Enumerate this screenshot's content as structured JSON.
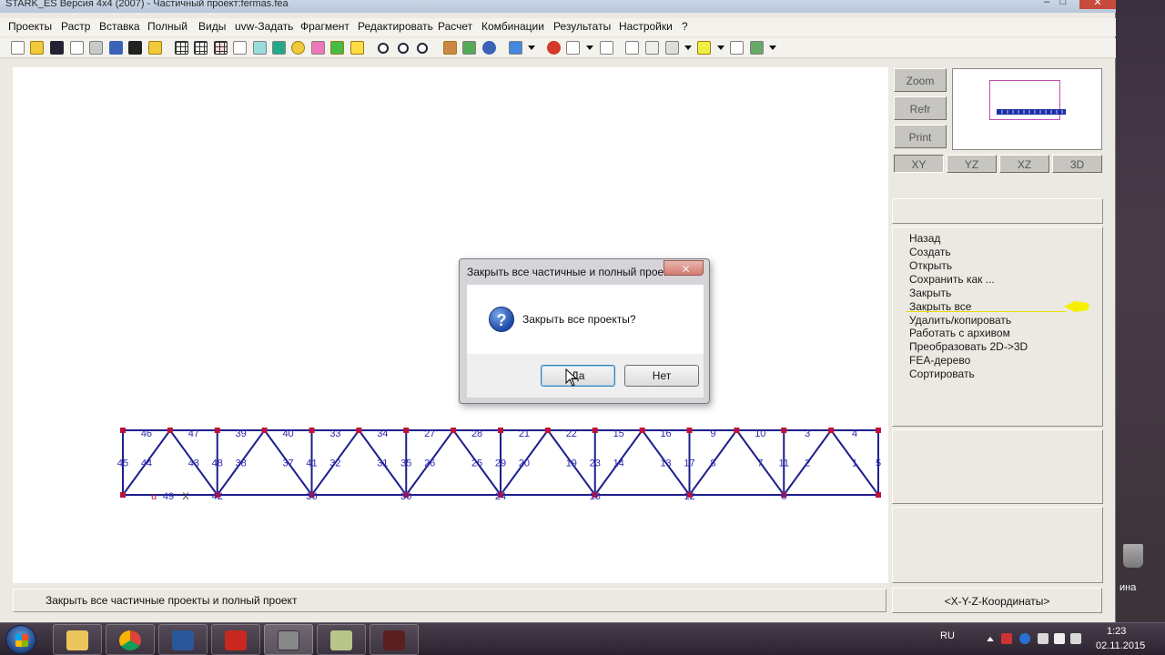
{
  "window": {
    "title": "STARK_ES Версия 4x4 (2007)  - Частичный проект:fermas.fea",
    "minimize_glyph": "–",
    "maximize_glyph": "□",
    "close_glyph": "✕"
  },
  "menu": [
    "Проекты",
    "Растр",
    "Вставка",
    "Полный",
    "Виды",
    "uvw-Задать",
    "Фрагмент",
    "Редактировать",
    "Расчет",
    "Комбинации",
    "Результаты",
    "Настройки",
    "?"
  ],
  "status_bar": {
    "text": "Закрыть все частичные проекты и полный проект"
  },
  "view_buttons": {
    "zoom": "Zoom",
    "refr": "Refr",
    "print": "Print"
  },
  "plane_tabs": [
    "XY",
    "YZ",
    "XZ",
    "3D"
  ],
  "project_menu": {
    "items": [
      "Назад",
      "Создать",
      "Открыть",
      "Сохранить как ...",
      "Закрыть",
      "Закрыть все",
      "Удалить/копировать",
      "Работать с архивом",
      "Преобразовать 2D->3D",
      "FEA-дерево",
      "Сортировать"
    ],
    "active_item": "Закрыть все"
  },
  "coordinates_button": "<X-Y-Z-Координаты>",
  "dialog": {
    "title": "Закрыть все частичные и полный проект...",
    "message": "Закрыть все проекты?",
    "icon": "question-icon",
    "yes": "Да",
    "no": "Нет"
  },
  "truss": {
    "top_labels": [
      "46",
      "47",
      "39",
      "40",
      "33",
      "34",
      "27",
      "28",
      "21",
      "22",
      "15",
      "16",
      "9",
      "10",
      "3",
      "4"
    ],
    "diagonal_labels": [
      "45",
      "44",
      "43",
      "48",
      "38",
      "37",
      "41",
      "32",
      "31",
      "35",
      "26",
      "25",
      "29",
      "20",
      "19",
      "23",
      "14",
      "13",
      "17",
      "8",
      "7",
      "11",
      "2",
      "1",
      "5"
    ],
    "bottom_labels": [
      "u",
      "49",
      "X",
      "42",
      "36",
      "30",
      "24",
      "18",
      "12",
      "6"
    ]
  },
  "desktop_label": "ина",
  "taskbar": {
    "apps": [
      "explorer-icon",
      "chrome-icon",
      "word-icon",
      "acrobat-icon",
      "stark-icon",
      "notepad-icon",
      "tool-icon"
    ],
    "language": "RU",
    "time": "1:23",
    "date": "02.11.2015"
  }
}
